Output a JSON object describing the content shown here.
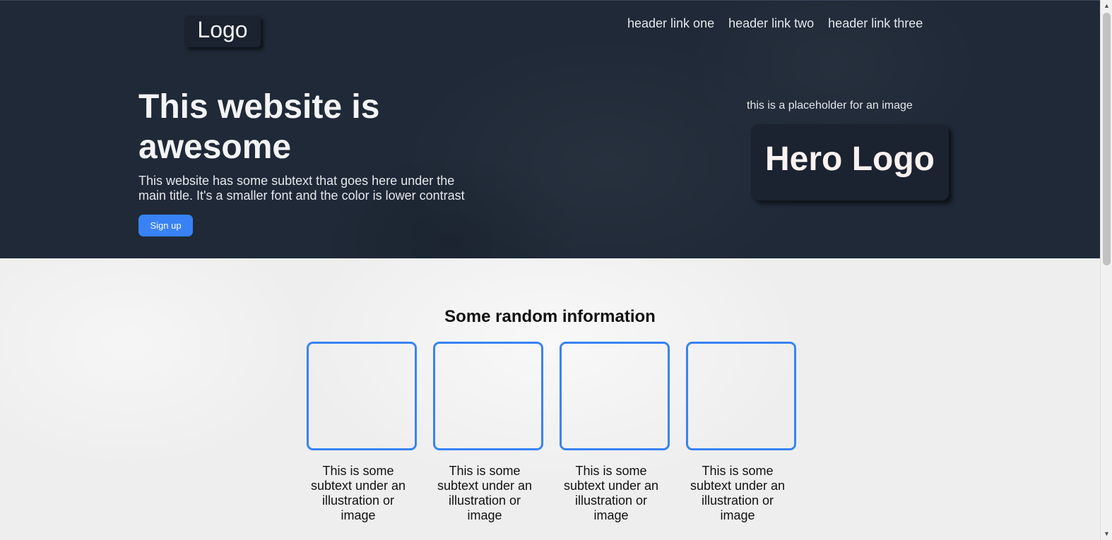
{
  "header": {
    "logo": "Logo",
    "nav_links": [
      "header link one",
      "header link two",
      "header link three"
    ]
  },
  "hero": {
    "title": "This website is awesome",
    "subtitle": "This website has some subtext that goes here under the main title. It's a smaller font and the color is lower contrast",
    "cta_label": "Sign up",
    "image_placeholder_text": "this is a placeholder for an image",
    "hero_logo": "Hero Logo"
  },
  "info": {
    "title": "Some random information",
    "cards": [
      {
        "text": "This is some subtext under an illustration or image"
      },
      {
        "text": "This is some subtext under an illustration or image"
      },
      {
        "text": "This is some subtext under an illustration or image"
      },
      {
        "text": "This is some subtext under an illustration or image"
      }
    ]
  },
  "scrollbar": {
    "up_icon": "triangle-up",
    "down_icon": "triangle-down"
  },
  "colors": {
    "hero_background": "#1f2937",
    "accent": "#3882f6",
    "page_background": "#eeeeee"
  }
}
